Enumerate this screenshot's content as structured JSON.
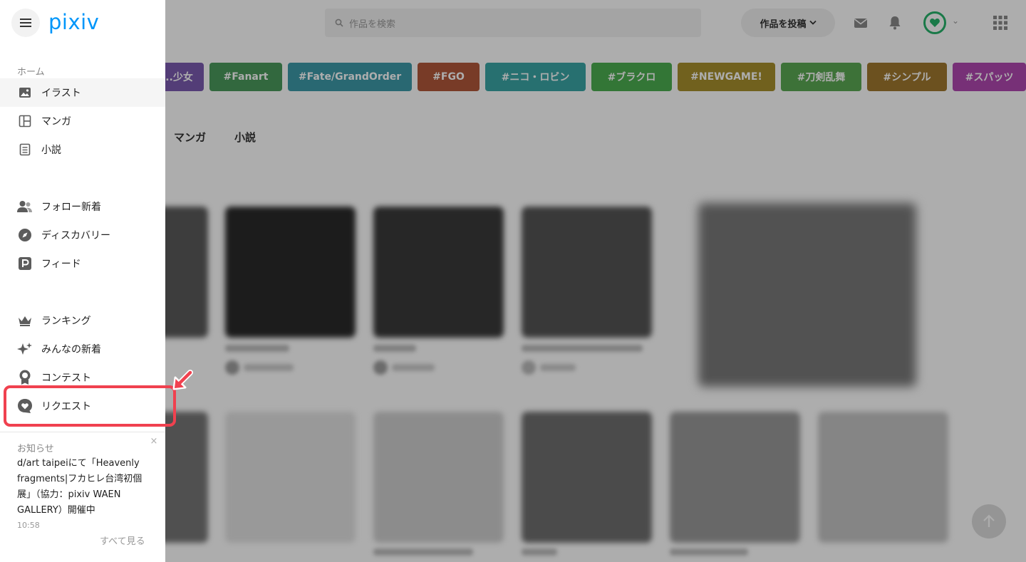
{
  "header": {
    "search_placeholder": "作品を検索",
    "post_button_label": "作品を投稿",
    "mail_icon": "mail-icon",
    "bell_icon": "bell-icon",
    "apps_icon": "grid-icon"
  },
  "tags": [
    {
      "label": "#...少女",
      "color": "#7b5ab0"
    },
    {
      "label": "#Fanart",
      "color": "#4a9a5c"
    },
    {
      "label": "#Fate/GrandOrder",
      "color": "#3d9aa8"
    },
    {
      "label": "#FGO",
      "color": "#b2583a"
    },
    {
      "label": "#ニコ・ロビン",
      "color": "#3aa6a6"
    },
    {
      "label": "#ブラクロ",
      "color": "#4caf50"
    },
    {
      "label": "#NEWGAME!",
      "color": "#a7902d"
    },
    {
      "label": "#刀剣乱舞",
      "color": "#5aa853"
    },
    {
      "label": "#シンプル",
      "color": "#a0782e"
    },
    {
      "label": "#スパッツ",
      "color": "#b048b0"
    }
  ],
  "subtabs": [
    "マンガ",
    "小説"
  ],
  "drawer": {
    "logo": "pixiv",
    "section_title": "ホーム",
    "items": [
      {
        "label": "イラスト",
        "icon": "image-icon"
      },
      {
        "label": "マンガ",
        "icon": "manga-icon"
      },
      {
        "label": "小説",
        "icon": "novel-icon"
      },
      {
        "label": "フォロー新着",
        "icon": "users-icon"
      },
      {
        "label": "ディスカバリー",
        "icon": "compass-icon"
      },
      {
        "label": "フィード",
        "icon": "feed-icon"
      },
      {
        "label": "ランキング",
        "icon": "crown-icon"
      },
      {
        "label": "みんなの新着",
        "icon": "sparkle-icon"
      },
      {
        "label": "コンテスト",
        "icon": "medal-icon"
      },
      {
        "label": "リクエスト",
        "icon": "request-heart-icon"
      }
    ]
  },
  "notice": {
    "title": "お知らせ",
    "close": "×",
    "text": "d/art taipeiにて「Heavenly fragments|フカヒレ台湾初個展」（協力：pixiv WAEN GALLERY）開催中",
    "time": "10:58",
    "see_all": "すべて見る"
  },
  "colors": {
    "brand": "#0096fa",
    "highlight": "#f0414f",
    "avatar_ring": "#27b36b"
  }
}
